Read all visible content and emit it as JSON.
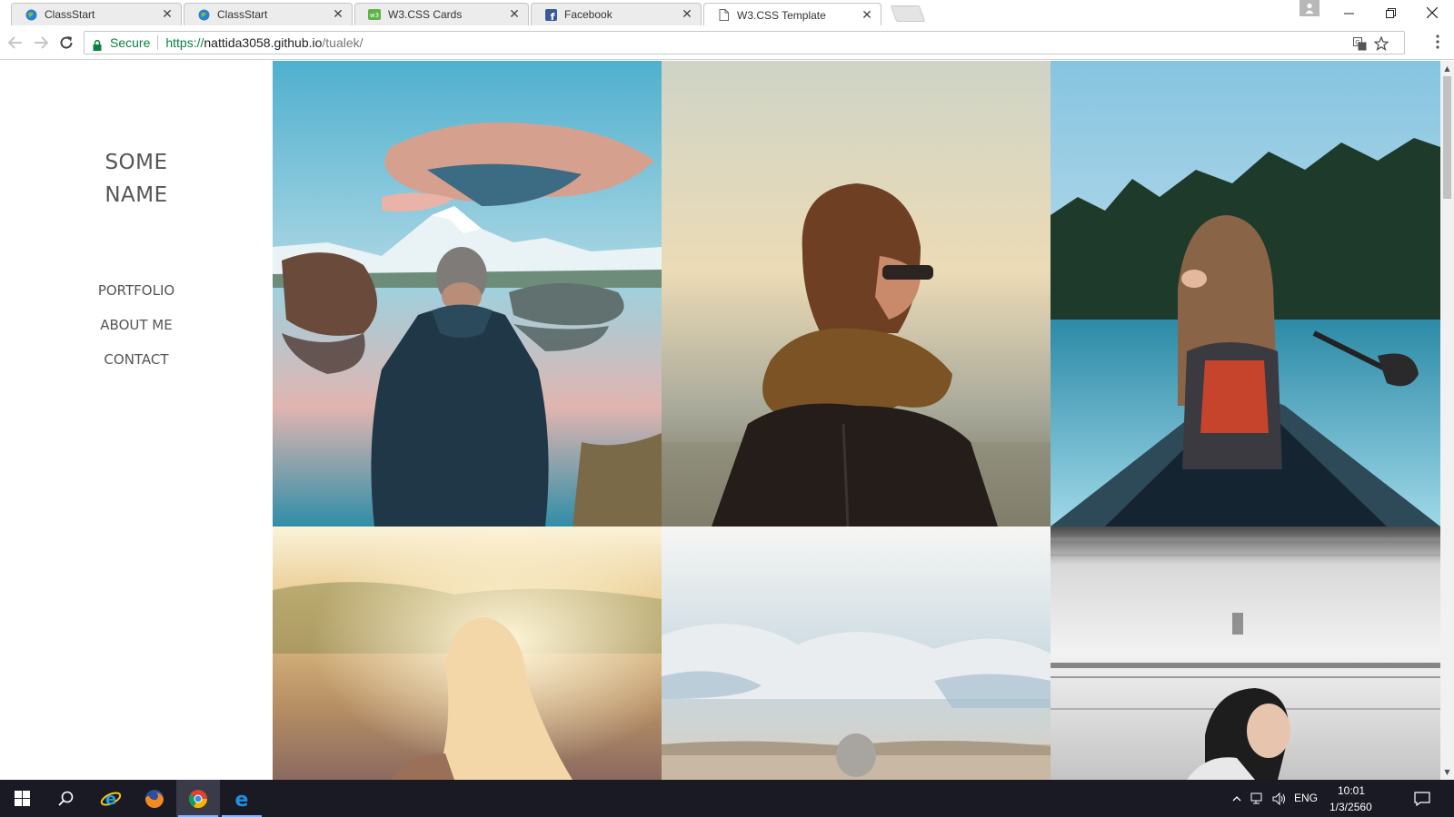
{
  "browser": {
    "tabs": [
      {
        "label": "ClassStart",
        "icon": "globe-icon",
        "active": false
      },
      {
        "label": "ClassStart",
        "icon": "globe-icon",
        "active": false
      },
      {
        "label": "W3.CSS Cards",
        "icon": "w3-icon",
        "active": false
      },
      {
        "label": "Facebook",
        "icon": "facebook-icon",
        "active": false
      },
      {
        "label": "W3.CSS Template",
        "icon": "page-icon",
        "active": true
      }
    ],
    "secure_label": "Secure",
    "url_scheme": "https://",
    "url_host": "nattida3058.github.io",
    "url_path": "/tualek/"
  },
  "site": {
    "name_line1": "SOME",
    "name_line2": "NAME",
    "nav": [
      "PORTFOLIO",
      "ABOUT ME",
      "CONTACT"
    ]
  },
  "gallery": {
    "photos": [
      {
        "subject": "man-mountain-lake-photo"
      },
      {
        "subject": "person-scarf-sunglasses-photo"
      },
      {
        "subject": "woman-canoe-lake-photo"
      },
      {
        "subject": "blonde-woman-sunlight-photo"
      },
      {
        "subject": "elderly-person-clouds-photo"
      },
      {
        "subject": "woman-train-blur-photo"
      }
    ]
  },
  "taskbar": {
    "language": "ENG",
    "time": "10:01",
    "date": "1/3/2560"
  },
  "colors": {
    "secure_green": "#0b8043",
    "sidebar_text": "#555555",
    "taskbar_bg": "#1a1a24"
  }
}
